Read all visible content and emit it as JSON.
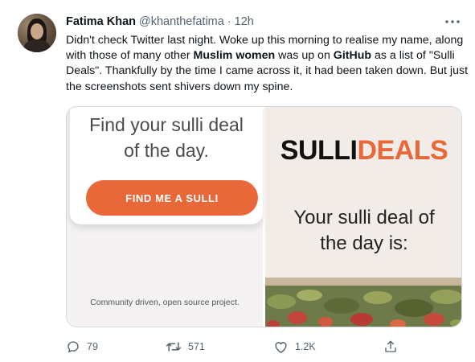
{
  "tweet": {
    "author_name": "Fatima Khan",
    "author_handle": "@khanthefatima",
    "separator": "·",
    "time": "12h",
    "text_parts": [
      "Didn't check Twitter last night. Woke up this morning to realise my name, along with those of many other ",
      "Muslim women",
      " was up on ",
      "GitHub",
      " as a list of \"Sulli Deals\". Thankfully by the time I came across it, it had been taken down. But just the screenshots sent shivers down my spine."
    ]
  },
  "media": {
    "left": {
      "headline_line1": "Find your sulli deal",
      "headline_line2": "of the day.",
      "button_label": "FIND ME A SULLI",
      "footer": "Community driven, open source project."
    },
    "right": {
      "brand_part1": "SULLI",
      "brand_part2": "DEALS",
      "line1": "Your sulli deal of",
      "line2": "the day is:"
    }
  },
  "actions": {
    "replies": "79",
    "retweets": "571",
    "likes": "1.2K"
  },
  "colors": {
    "accent_orange": "#e8683a",
    "muted_text": "#536471"
  },
  "icons": [
    "more-icon",
    "reply-icon",
    "retweet-icon",
    "like-icon",
    "share-icon"
  ]
}
